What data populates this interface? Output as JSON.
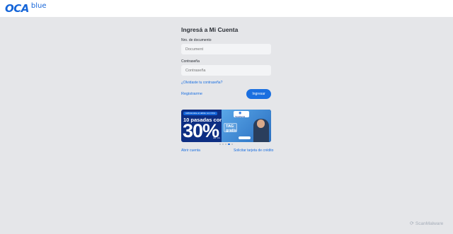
{
  "header": {
    "logo_brand": "OCA",
    "logo_sub": "blue"
  },
  "login": {
    "title": "Ingresá a Mi Cuenta",
    "document": {
      "label": "Nro. de documento",
      "placeholder": "Document"
    },
    "password": {
      "label": "Contraseña",
      "placeholder": "Contraseña"
    },
    "forgot_link": "¿Olvidaste tu contraseña?",
    "register_link": "Registrarme",
    "submit_label": "Ingresar"
  },
  "banner": {
    "tagline": "Adhiriéndote al débito con OCA",
    "headline": "10 pasadas con",
    "percent": "30%",
    "note": "dto. c/u",
    "brand": "TELEPEAJE",
    "tag_text": "TAG gratis"
  },
  "carousel": {
    "count": 5,
    "active_index": 3
  },
  "footer": {
    "open_account": "Abrir cuenta",
    "request_card": "Solicitar tarjeta de crédito"
  },
  "watermark": {
    "text": "ScanMalware",
    "icon": "scanmalware-icon"
  },
  "colors": {
    "accent": "#1a6fe0",
    "background": "#e5e6e9",
    "banner_dark": "#0d2e83"
  }
}
